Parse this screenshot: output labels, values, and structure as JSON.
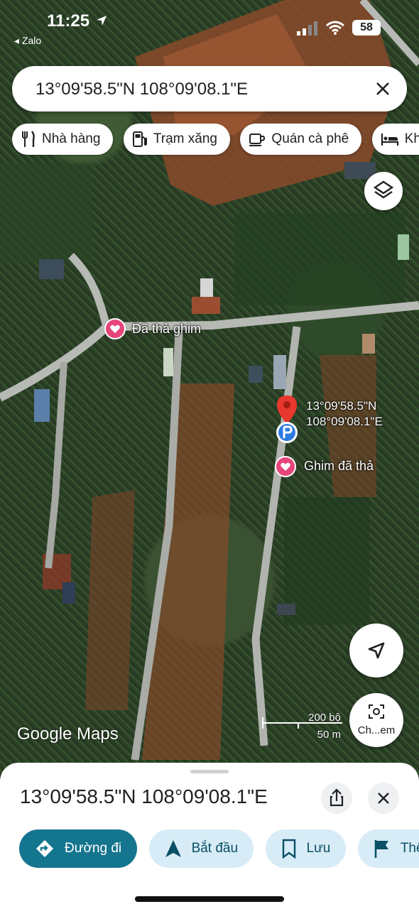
{
  "status_bar": {
    "time": "11:25",
    "back_app": "◂ Zalo",
    "battery": "58"
  },
  "search": {
    "value": "13°09'58.5\"N 108°09'08.1\"E"
  },
  "chips": [
    {
      "label": "Nhà hàng",
      "icon": "fork-knife-icon"
    },
    {
      "label": "Trạm xăng",
      "icon": "gas-station-icon"
    },
    {
      "label": "Quán cà phê",
      "icon": "coffee-cup-icon"
    },
    {
      "label": "Kh",
      "icon": "hotel-bed-icon"
    }
  ],
  "map": {
    "pin_top": "Đã thả ghim",
    "pin_bottom": "Ghim đã thả",
    "coord_line1": "13°09'58.5\"N",
    "coord_line2": "108°09'08.1\"E",
    "google_logo": "Google Maps",
    "scale_top": "200 bộ",
    "scale_bottom": "50 m",
    "screen_button_label": "Ch...em"
  },
  "sheet": {
    "title": "13°09'58.5\"N 108°09'08.1\"E",
    "actions": [
      {
        "label": "Đường đi",
        "icon": "directions-icon"
      },
      {
        "label": "Bắt đầu",
        "icon": "navigation-arrow-icon"
      },
      {
        "label": "Lưu",
        "icon": "bookmark-icon"
      },
      {
        "label": "Thê",
        "icon": "flag-icon"
      }
    ]
  },
  "colors": {
    "accent": "#14758f",
    "action_bg": "#d7ecf6",
    "pin_red": "#e8372c",
    "heart_pink": "#e6457a"
  }
}
